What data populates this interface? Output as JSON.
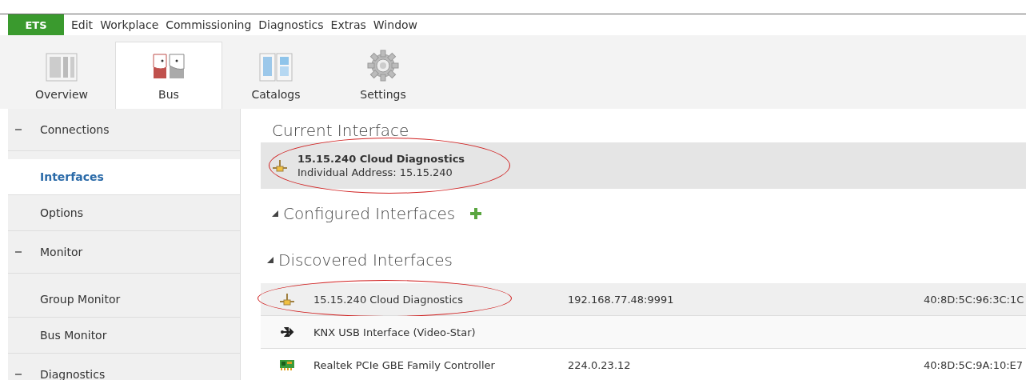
{
  "menu": {
    "app": "ETS",
    "items": [
      "Edit",
      "Workplace",
      "Commissioning",
      "Diagnostics",
      "Extras",
      "Window"
    ]
  },
  "ribbon": [
    {
      "label": "Overview",
      "kind": "overview",
      "selected": false
    },
    {
      "label": "Bus",
      "kind": "bus",
      "selected": true
    },
    {
      "label": "Catalogs",
      "kind": "catalogs",
      "selected": false
    },
    {
      "label": "Settings",
      "kind": "settings",
      "selected": false
    }
  ],
  "sidebar": [
    {
      "label": "Connections",
      "expanded": true,
      "children": [
        {
          "label": "Interfaces",
          "selected": true
        },
        {
          "label": "Options",
          "selected": false
        }
      ]
    },
    {
      "label": "Monitor",
      "expanded": true,
      "children": [
        {
          "label": "Group Monitor",
          "selected": false
        },
        {
          "label": "Bus Monitor",
          "selected": false
        }
      ]
    },
    {
      "label": "Diagnostics",
      "expanded": true
    }
  ],
  "current": {
    "title": "Current Interface",
    "name": "15.15.240 Cloud Diagnostics",
    "address": "Individual Address: 15.15.240",
    "highlighted": true
  },
  "configured": {
    "title": "Configured Interfaces",
    "expanded": true
  },
  "discovered": {
    "title": "Discovered Interfaces",
    "expanded": true,
    "rows": [
      {
        "kind": "network",
        "name": "15.15.240 Cloud Diagnostics",
        "address": "192.168.77.48:9991",
        "mac": "40:8D:5C:96:3C:1C",
        "selected": true,
        "highlighted": true
      },
      {
        "kind": "usb",
        "name": "KNX USB Interface (Video-Star)",
        "selected": false,
        "highlighted": false
      },
      {
        "kind": "card",
        "name": "Realtek PCIe GBE Family Controller",
        "address": "224.0.23.12",
        "mac": "40:8D:5C:9A:10:E7",
        "selected": false,
        "highlighted": false
      }
    ]
  }
}
